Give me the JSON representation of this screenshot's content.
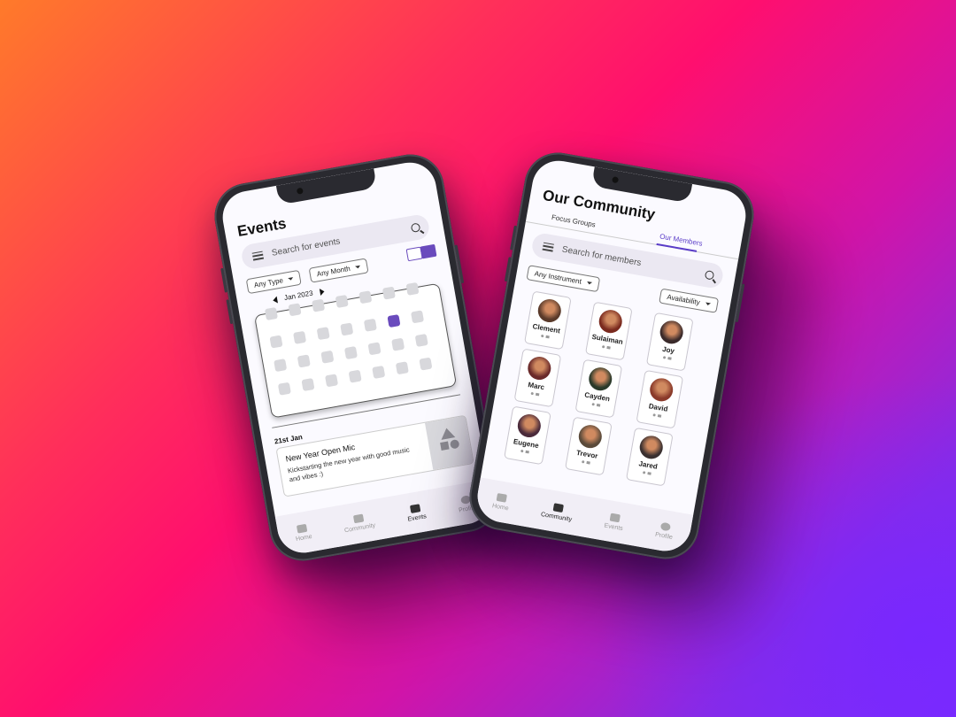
{
  "events_screen": {
    "title": "Events",
    "search_placeholder": "Search for events",
    "filter_type": "Any Type",
    "filter_month": "Any Month",
    "month_label": "Jan 2023",
    "event_date": "21st Jan",
    "event_title": "New Year Open Mic",
    "event_desc": "Kickstarting the new year with good music and vibes :)",
    "nav": [
      "Home",
      "Community",
      "Events",
      "Profile"
    ],
    "active_nav": "Events"
  },
  "community_screen": {
    "title": "Our Community",
    "tabs": [
      "Focus Groups",
      "Our Members"
    ],
    "active_tab": "Our Members",
    "search_placeholder": "Search for members",
    "filter_instrument": "Any Instrument",
    "filter_availability": "Availability",
    "members": [
      "Clement",
      "Sulaiman",
      "Joy",
      "Marc",
      "Cayden",
      "David",
      "Eugene",
      "Trevor",
      "Jared"
    ],
    "nav": [
      "Home",
      "Community",
      "Events",
      "Profile"
    ],
    "active_nav": "Community"
  },
  "colors": {
    "accent": "#6a4bbd",
    "tab_active": "#5a3cc8"
  },
  "icons": [
    "menu-icon",
    "search-icon",
    "home-icon",
    "community-icon",
    "calendar-icon",
    "profile-icon",
    "list-view-icon",
    "calendar-view-icon",
    "shapes-placeholder-icon"
  ]
}
